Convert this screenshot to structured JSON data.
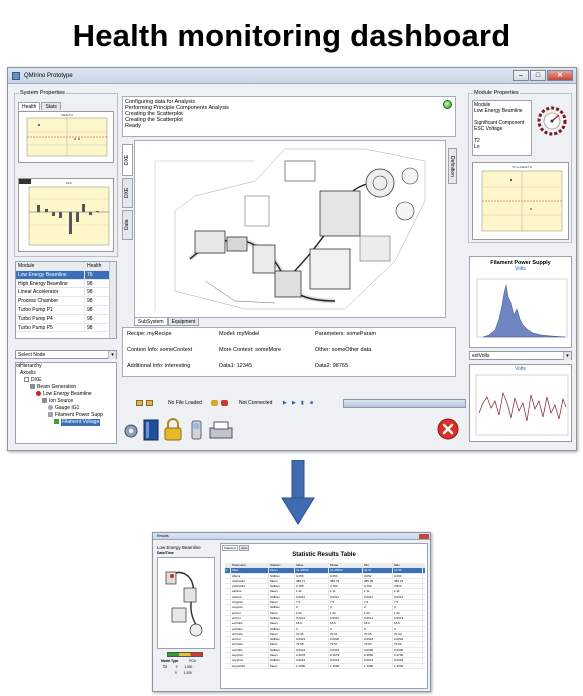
{
  "page_title": "Health monitoring dashboard",
  "app": {
    "title": "QMIrino Prototype"
  },
  "left": {
    "system_properties": "System Properties",
    "tabs": [
      "Health",
      "Stats"
    ],
    "table_headers": [
      "Module",
      "Health"
    ],
    "table_rows": [
      {
        "module": "Low Energy Beamline",
        "health": "76"
      },
      {
        "module": "High Energy Beamline",
        "health": "98"
      },
      {
        "module": "Linear Accelerator",
        "health": "98"
      },
      {
        "module": "Process Chamber",
        "health": "98"
      },
      {
        "module": "Turbo Pump P1",
        "health": "98"
      },
      {
        "module": "Turbo Pump P4",
        "health": "98"
      },
      {
        "module": "Turbo Pump P5",
        "health": "98"
      }
    ],
    "select_node": "Select Node",
    "tree": [
      "otHierarchy",
      "Axcelis",
      "DXE",
      "Beam Generation",
      "Low Energy Beamline",
      "Ion Source",
      "Gauge IG1",
      "Filament Power Supp",
      "Filament Voltage"
    ]
  },
  "center": {
    "log_lines": [
      "Configuring data for Analysis",
      "Performing Principle Components Analysis",
      "Creating the Scatterplot",
      "Creating the Scatterplot",
      "Ready"
    ],
    "vtabs": [
      "DXE",
      "DXE",
      "Data"
    ],
    "definition_tab": "Definition",
    "bottom_tabs": [
      "SubSystem",
      "Equipment"
    ],
    "info": {
      "recipe": "Recipe: myRecipe",
      "model": "Model: myModel",
      "parameters": "Parameters: someParam",
      "context": "Context Info: someContext",
      "more_context": "More Context: someMore",
      "other": "Other: someOther data",
      "additional": "Additional Info: interesting",
      "data1": "Data1: 12345",
      "data2": "Data2: 98765"
    },
    "status_file": "No File Loaded",
    "status_conn": "Not Connected"
  },
  "right": {
    "module_properties": "Module Properties",
    "module_list": [
      "Module",
      "Low Energy Beamline",
      "",
      "Significant Component",
      "ESC Voltage",
      "",
      "T2",
      "Lo"
    ],
    "filament_title": "Filament Power Supply",
    "filament_sub": "Volts",
    "select_value": "extVolts",
    "lower_chart_title": "Volts"
  },
  "results": {
    "window_title": "Results",
    "module": "Low Energy Beamline",
    "date_label": "Date/Time",
    "tabs": [
      "Statistics",
      "plots"
    ],
    "table_title": "Statistic Results Table",
    "headers": [
      "",
      "Parameter",
      "Statistic",
      "Value",
      "Model",
      "Min",
      "Max"
    ],
    "rows": [
      [
        "▸",
        "fGas",
        "Mean",
        "41.46032",
        "41.45693",
        "41.37",
        "41.55"
      ],
      [
        "",
        "sfEcur",
        "StdDev",
        "0.056",
        "0.054",
        "0.052",
        "0.060"
      ],
      [
        "",
        "outHVolts",
        "Mean",
        "485.71",
        "480.79",
        "485.05",
        "486.23"
      ],
      [
        "",
        "outHVolts",
        "StdDev",
        "0.785",
        "0.780",
        "0.762",
        "0.820"
      ],
      [
        "",
        "cattCur",
        "Mean",
        "1.11",
        "1.11",
        "1.11",
        "1.11"
      ],
      [
        "",
        "cattCur",
        "StdDev",
        "0.0011",
        "0.0011",
        "0.0011",
        "0.0012"
      ],
      [
        "",
        "cnsgCur",
        "Mean",
        "7.5",
        "7.5",
        "7.5",
        "7.5"
      ],
      [
        "",
        "cnsgCur",
        "StdDev",
        "0",
        "0",
        "0",
        "0"
      ],
      [
        "",
        "arcCur",
        "Mean",
        "1.02",
        "1.02",
        "1.02",
        "1.02"
      ],
      [
        "",
        "arcCur",
        "StdDev",
        "0.0012",
        "0.0011",
        "0.0011",
        "0.0013"
      ],
      [
        "",
        "extVolts",
        "Mean",
        "18.6",
        "18.6",
        "18.6",
        "18.6"
      ],
      [
        "",
        "extVolts",
        "StdDev",
        "0",
        "0",
        "0",
        "0"
      ],
      [
        "",
        "arcVolts",
        "Mean",
        "70.35",
        "70.31",
        "70.25",
        "70.43"
      ],
      [
        "",
        "arcCur",
        "StdDev",
        "0.0021",
        "0.0020",
        "0.0018",
        "0.0022"
      ],
      [
        "",
        "arcVolts",
        "Mean",
        "79.58",
        "79.57",
        "79.50",
        "79.66"
      ],
      [
        "",
        "extVolts",
        "StdDev",
        "0.0314",
        "0.0314",
        "0.0300",
        "0.0330"
      ],
      [
        "",
        "suppCur",
        "Mean",
        "0.4678",
        "0.4679",
        "0.4660",
        "0.4700"
      ],
      [
        "",
        "suppCur",
        "StdDev",
        "0.0014",
        "0.0014",
        "0.0012",
        "0.0016"
      ],
      [
        "",
        "suppVolts",
        "Mean",
        "1.1990",
        "1.1990",
        "1.1980",
        "1.2000"
      ]
    ],
    "bottom_labels": [
      "Model",
      "Type",
      "PCA",
      "T2",
      "9",
      "1.000",
      "9",
      "1.000"
    ]
  }
}
